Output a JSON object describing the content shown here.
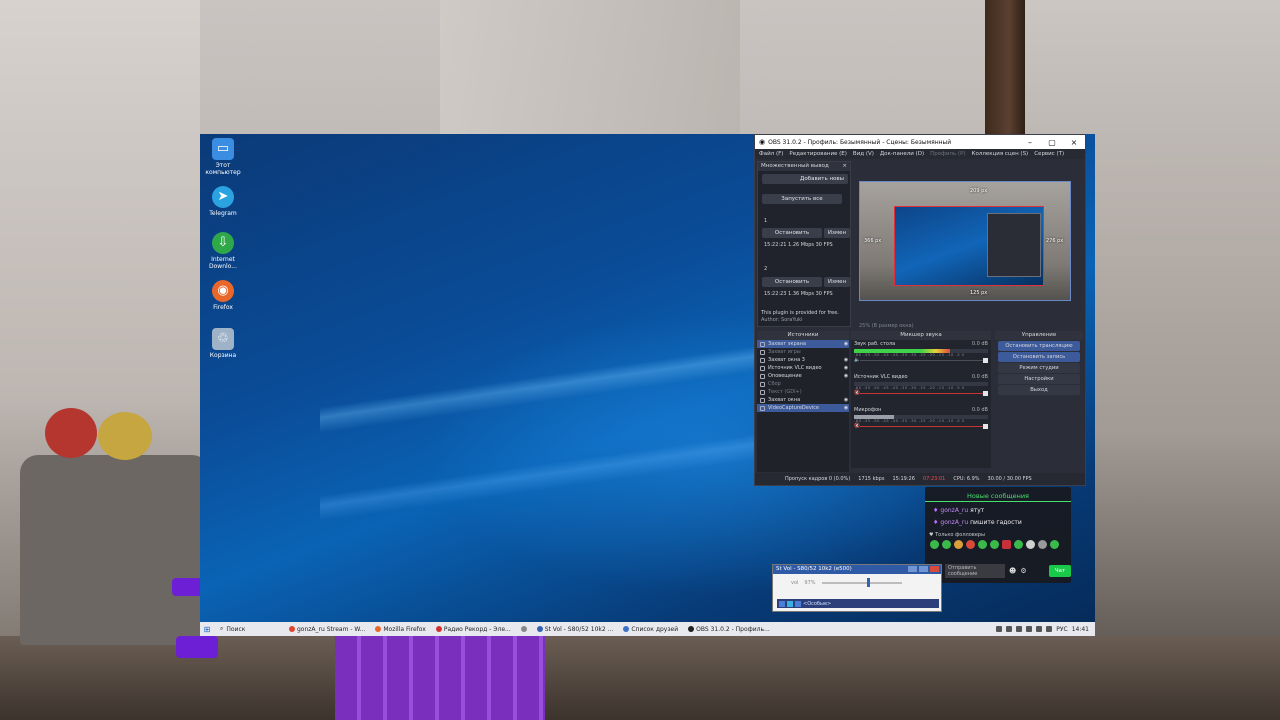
{
  "desktop": {
    "icons": [
      {
        "label": "Этот компьютер",
        "icon": "computer-icon",
        "color": "#3a8de0"
      },
      {
        "label": "Telegram",
        "icon": "telegram-icon",
        "color": "#2aa3e0"
      },
      {
        "label": "Internet Downlo...",
        "icon": "internet-download-icon",
        "color": "#2fa84a"
      },
      {
        "label": "Firefox",
        "icon": "firefox-icon",
        "color": "#e8672a"
      },
      {
        "label": "Корзина",
        "icon": "recycle-bin-icon",
        "color": "#9fb3c8"
      }
    ]
  },
  "taskbar": {
    "search_label": "Поиск",
    "items": [
      {
        "label": "gonzA_ru Stream - W...",
        "color": "#e0462b"
      },
      {
        "label": "Mozilla Firefox",
        "color": "#e8672a"
      },
      {
        "label": "Радио Рекорд - Эле...",
        "color": "#d33131"
      },
      {
        "label": "",
        "color": "#888888"
      },
      {
        "label": "St Vol - S80/52 10k2 ...",
        "color": "#3261b0"
      },
      {
        "label": "Список друзей",
        "color": "#3a70c8"
      },
      {
        "label": "OBS 31.0.2 - Профиль...",
        "color": "#202020"
      }
    ],
    "lang": "РУС",
    "time": "14:41"
  },
  "obs": {
    "title": "OBS 31.0.2 - Профиль: Безымянный - Сцены: Безымянный",
    "menu": [
      "Файл (F)",
      "Редактирование (E)",
      "Вид (V)",
      "Док-панели (D)",
      "Профиль (P)",
      "Коллекция сцен (S)",
      "Сервис (T)"
    ],
    "menu_disabled_index": 4,
    "multi_output": {
      "header": "Множественный вывод",
      "add_button": "Добавить новы",
      "start_all": "Запустить все",
      "outputs": [
        {
          "index": "1",
          "stop": "Остановить",
          "edit": "Измен",
          "stats": "15:22:21 1.26 Mbps 30 FPS"
        },
        {
          "index": "2",
          "stop": "Остановить",
          "edit": "Измен",
          "stats": "15:22:23 1.36 Mbps 30 FPS"
        }
      ],
      "footer": "This plugin is provided for free.",
      "footer2": "Author: SoraYuki"
    },
    "preview": {
      "top": "209 px",
      "left": "366 px",
      "right": "276 px",
      "bottom": "125 px",
      "caption": "25% (В размер окна)"
    },
    "docks": {
      "sources": "Источники",
      "mixer": "Микшер звука",
      "controls": "Управление"
    },
    "sources": [
      {
        "label": "Захват экрана",
        "active": true,
        "hidden": false
      },
      {
        "label": "Захват игры",
        "active": false,
        "hidden": true
      },
      {
        "label": "Захват окна 3",
        "active": false,
        "hidden": false
      },
      {
        "label": "Источник VLC видео",
        "active": false,
        "hidden": false
      },
      {
        "label": "Оповещение",
        "active": false,
        "hidden": false
      },
      {
        "label": "Сбор",
        "active": false,
        "hidden": true
      },
      {
        "label": "Текст (GDI+)",
        "active": false,
        "hidden": true
      },
      {
        "label": "Захват окна",
        "active": false,
        "hidden": false
      },
      {
        "label": "VideoCaptureDevice",
        "active": true,
        "hidden": false
      }
    ],
    "mixer": [
      {
        "name": "Звук раб. стола",
        "db": "0.0 dB",
        "level": 0.72,
        "muted": false
      },
      {
        "name": "Источник VLC видео",
        "db": "0.0 dB",
        "level": 0.0,
        "muted": true
      },
      {
        "name": "Микрофон",
        "db": "0.0 dB",
        "level": 0.3,
        "muted": true
      }
    ],
    "meter_scale": "-60 -55 -50 -45 -40 -35 -30 -25 -20 -15 -10 -5 0",
    "controls": [
      {
        "label": "Остановить трансляцию",
        "highlight": true
      },
      {
        "label": "Остановить запись",
        "highlight": true
      },
      {
        "label": "Режим студии",
        "highlight": false
      },
      {
        "label": "Настройки",
        "highlight": false
      },
      {
        "label": "Выход",
        "highlight": false
      }
    ],
    "status": {
      "dropped": "Пропуск кадров 0 (0.0%)",
      "bitrate": "1715 kbps",
      "stream_time": "15:19:26",
      "rec_time": "07:23:01",
      "cpu": "CPU: 6.9%",
      "fps": "30.00 / 30.00 FPS"
    }
  },
  "chat": {
    "title": "Новые сообщения",
    "messages": [
      {
        "user": "gonzA_ru",
        "text": "ятут"
      },
      {
        "user": "gonzA_ru",
        "text": "пишите гадости"
      }
    ],
    "followers_only": "Только фолловеры",
    "input_placeholder": "Отправить сообщение",
    "send_label": "Чат",
    "accent": "#46e06a"
  },
  "volume": {
    "title": "St Vol - S80/52 10k2 (e500)",
    "label": "vol",
    "value": "97%",
    "level": 0.57,
    "bar_text": "<Особые>"
  }
}
